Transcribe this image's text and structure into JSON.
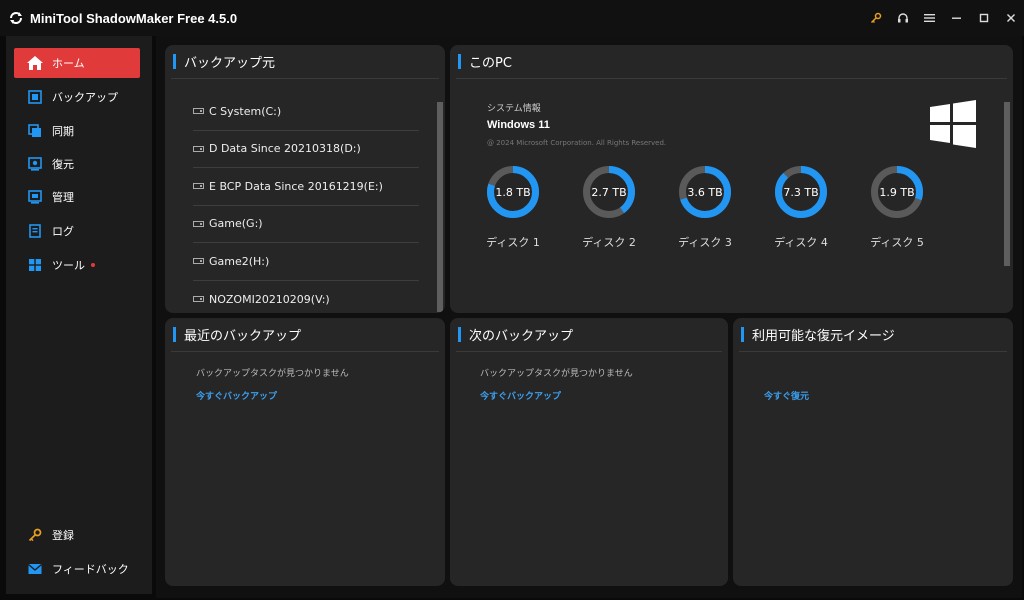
{
  "app": {
    "title": "MiniTool ShadowMaker Free 4.5.0"
  },
  "window_controls": [
    "key-icon",
    "headset-icon",
    "menu-icon",
    "minimize-icon",
    "maximize-icon",
    "close-icon"
  ],
  "colors": {
    "accent_red": "#e03a3a",
    "accent_blue": "#2196f3",
    "key_yellow": "#e8a020"
  },
  "sidebar": {
    "items": [
      {
        "label": "ホーム",
        "icon": "home-icon",
        "active": true
      },
      {
        "label": "バックアップ",
        "icon": "backup-icon"
      },
      {
        "label": "同期",
        "icon": "sync-icon"
      },
      {
        "label": "復元",
        "icon": "restore-icon"
      },
      {
        "label": "管理",
        "icon": "manage-icon"
      },
      {
        "label": "ログ",
        "icon": "log-icon"
      },
      {
        "label": "ツール",
        "icon": "tools-icon",
        "badge": true
      }
    ],
    "bottom": [
      {
        "label": "登録",
        "icon": "key-icon"
      },
      {
        "label": "フィードバック",
        "icon": "mail-icon"
      }
    ]
  },
  "backup_source": {
    "title": "バックアップ元",
    "items": [
      "C System(C:)",
      "D Data Since 20210318(D:)",
      "E BCP Data Since 20161219(E:)",
      "Game(G:)",
      "Game2(H:)",
      "NOZOMI20210209(V:)"
    ]
  },
  "this_pc": {
    "title": "このPC",
    "sysinfo_label": "システム情報",
    "os": "Windows 11",
    "copyright": "@ 2024 Microsoft Corporation. All Rights Reserved.",
    "disks": [
      {
        "label": "ディスク 1",
        "size": "1.8 TB",
        "used_fraction": 0.8
      },
      {
        "label": "ディスク 2",
        "size": "2.7 TB",
        "used_fraction": 0.4
      },
      {
        "label": "ディスク 3",
        "size": "3.6 TB",
        "used_fraction": 0.7
      },
      {
        "label": "ディスク 4",
        "size": "7.3 TB",
        "used_fraction": 0.88
      },
      {
        "label": "ディスク 5",
        "size": "1.9 TB",
        "used_fraction": 0.3
      }
    ]
  },
  "recent_backup": {
    "title": "最近のバックアップ",
    "message": "バックアップタスクが見つかりません",
    "action": "今すぐバックアップ"
  },
  "next_backup": {
    "title": "次のバックアップ",
    "message": "バックアップタスクが見つかりません",
    "action": "今すぐバックアップ"
  },
  "restore_images": {
    "title": "利用可能な復元イメージ",
    "action": "今すぐ復元"
  }
}
